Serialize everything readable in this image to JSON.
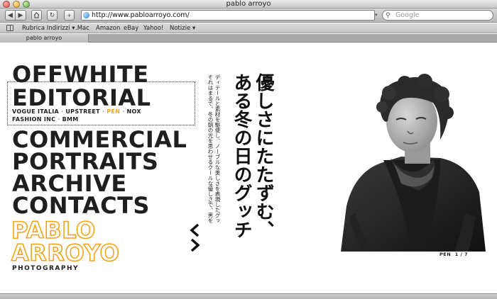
{
  "window": {
    "title": "pablo arroyo"
  },
  "toolbar": {
    "url": "http://www.pabloarroyo.com/",
    "search_placeholder": "Google",
    "back_icon": "back-arrow-icon",
    "forward_icon": "forward-arrow-icon",
    "home_icon": "home-icon",
    "reload_icon": "reload-icon",
    "add_icon": "plus-icon"
  },
  "bookmarks": [
    {
      "label": "Rubrica Indirizzi ▾"
    },
    {
      "label": ".Mac"
    },
    {
      "label": "Amazon"
    },
    {
      "label": "eBay"
    },
    {
      "label": "Yahoo!"
    },
    {
      "label": "Notizie ▾"
    }
  ],
  "tab": {
    "label": "pablo arroyo"
  },
  "site": {
    "menu": {
      "offwhite": "OFFWHITE",
      "editorial": "EDITORIAL",
      "commercial": "COMMERCIAL",
      "portraits": "PORTRAITS",
      "archive": "ARCHIVE",
      "contacts": "CONTACTS"
    },
    "editorial_sub": {
      "vogue": "VOGUE ITALIA",
      "upstreet": "UPSTREET",
      "pen": "PEN",
      "nox": "NOX",
      "fashion": "FASHION INC",
      "bmm": "BMM"
    },
    "brand_first": "PABLO",
    "brand_last": "ARROYO",
    "brand_sub": "PHOTOGRAPHY",
    "japanese_headline_1": "優しさにたたずむ、",
    "japanese_headline_2": "ある冬の日のグッチ",
    "japanese_body_1": "ディテールと素材を駆使し、ノーブルな美しさを表現したグッチのコレクション。",
    "japanese_body_2": "それはまるで、冬の朝の光を思わせるクールな優しさで、男を心地よく包みこむ。",
    "page_label": "PEN",
    "page_counter": "1 / 7"
  },
  "colors": {
    "accent": "#f4a41b",
    "text": "#1f1f1f"
  }
}
